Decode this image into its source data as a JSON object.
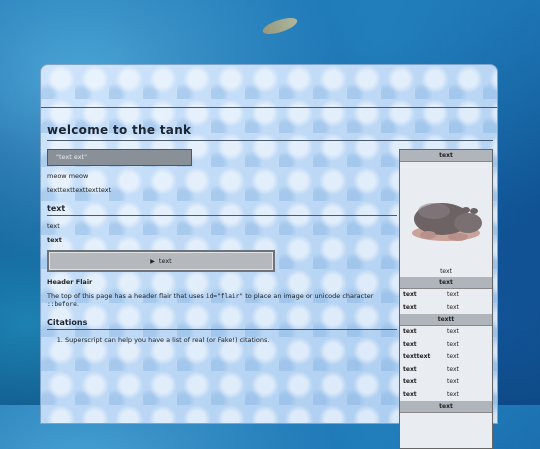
{
  "page": {
    "title": "welcome to the tank",
    "textbox_value": "\"text ext\"",
    "line1": "meow meow",
    "line2": "texttexttexttexttext"
  },
  "section_text": {
    "heading": "text",
    "para1": "text",
    "para2": "text",
    "button_label": "text",
    "header_flair_heading": "Header Flair",
    "flair_desc_before": "The top of this page has a header flair that uses ",
    "flair_code1": "id=\"flair\"",
    "flair_desc_middle": " to place an image or unicode character ",
    "flair_code2": "::before",
    "flair_desc_after": "."
  },
  "citations": {
    "heading": "Citations",
    "items": [
      "Superscript can help you have a list of real (or Fake!) citations."
    ]
  },
  "infobox": {
    "title": "text",
    "image_icon": "hippo-figure",
    "caption": "text",
    "section1_header": "text",
    "section1_rows": [
      {
        "key": "text",
        "value": "text"
      },
      {
        "key": "text",
        "value": "text"
      }
    ],
    "section2_header": "textt",
    "section2_rows": [
      {
        "key": "text",
        "value": "text"
      },
      {
        "key": "text",
        "value": "text"
      },
      {
        "key": "texttext",
        "value": "text"
      },
      {
        "key": "text",
        "value": "text"
      },
      {
        "key": "text",
        "value": "text"
      },
      {
        "key": "text",
        "value": "text"
      }
    ],
    "section3_header": "text"
  },
  "colors": {
    "panel": "#cfe4fb",
    "textbox": "#8a9097",
    "button": "#b5b8bc",
    "infobox_header": "#b0b5bb"
  }
}
